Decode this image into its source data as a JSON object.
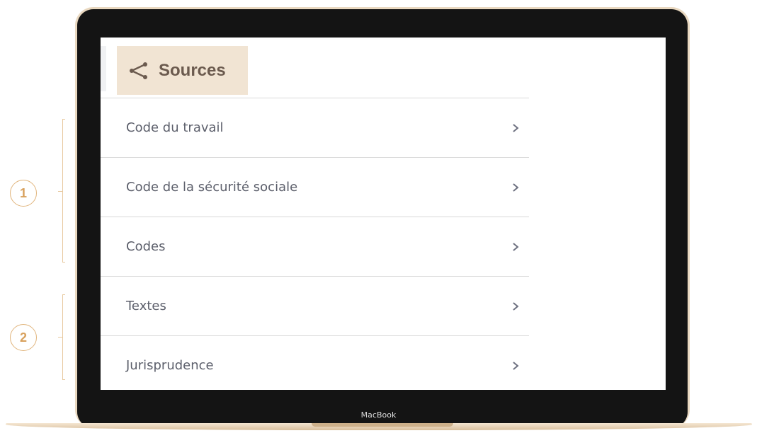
{
  "header": {
    "title": "Sources",
    "icon": "share-icon"
  },
  "menu": {
    "items": [
      {
        "label": "Code du travail",
        "icon": "chevron-right-icon"
      },
      {
        "label": "Code de la sécurité sociale",
        "icon": "chevron-right-icon"
      },
      {
        "label": "Codes",
        "icon": "chevron-right-icon"
      },
      {
        "label": "Textes",
        "icon": "chevron-right-icon"
      },
      {
        "label": "Jurisprudence",
        "icon": "chevron-right-icon"
      }
    ]
  },
  "annotations": {
    "badge_1": "1",
    "badge_2": "2"
  },
  "device": {
    "label": "MacBook"
  },
  "colors": {
    "header_bg": "#f1e4d3",
    "header_text": "#6b5a4e",
    "menu_text": "#5c5f6b",
    "annotation": "#d8a15d",
    "divider": "#d9d9d9"
  }
}
